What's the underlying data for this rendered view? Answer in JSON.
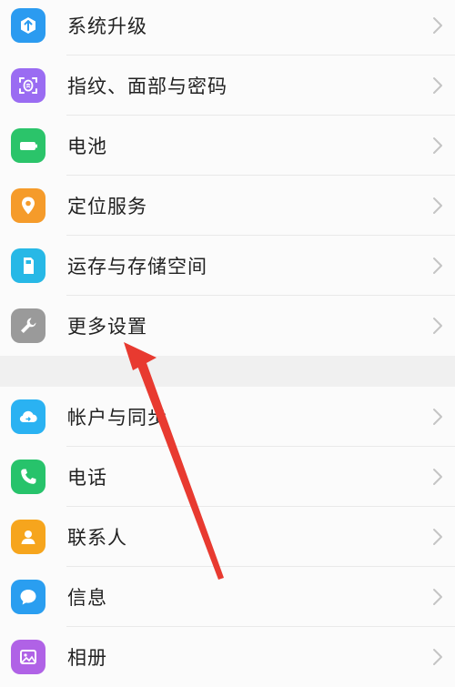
{
  "groups": [
    {
      "items": [
        {
          "label": "系统升级",
          "icon": "system-update-icon",
          "color": "#2b9bf0"
        },
        {
          "label": "指纹、面部与密码",
          "icon": "fingerprint-face-icon",
          "color": "#9a6cf2"
        },
        {
          "label": "电池",
          "icon": "battery-icon",
          "color": "#2bc46a"
        },
        {
          "label": "定位服务",
          "icon": "location-pin-icon",
          "color": "#f59b2a"
        },
        {
          "label": "运存与存储空间",
          "icon": "storage-icon",
          "color": "#27b8e6"
        },
        {
          "label": "更多设置",
          "icon": "wrench-icon",
          "color": "#9a9a9a"
        }
      ]
    },
    {
      "items": [
        {
          "label": "帐户与同步",
          "icon": "cloud-sync-icon",
          "color": "#2ab2f2"
        },
        {
          "label": "电话",
          "icon": "phone-icon",
          "color": "#27c36b"
        },
        {
          "label": "联系人",
          "icon": "contact-person-icon",
          "color": "#f6a51d"
        },
        {
          "label": "信息",
          "icon": "message-bubble-icon",
          "color": "#2a9ef0"
        },
        {
          "label": "相册",
          "icon": "photo-album-icon",
          "color": "#b062e6"
        }
      ]
    }
  ],
  "annotation": {
    "type": "red-arrow",
    "color": "#e83a30",
    "points_to": "更多设置"
  }
}
